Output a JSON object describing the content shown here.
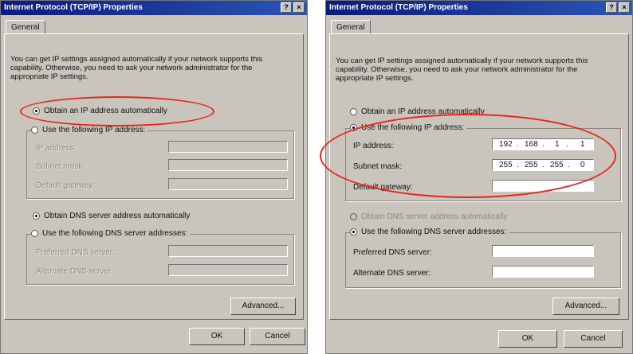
{
  "left_dialog": {
    "title": "Internet Protocol (TCP/IP) Properties",
    "help_btn": "?",
    "close_btn": "×",
    "tab": "General",
    "description": "You can get IP settings assigned automatically if your network supports this capability. Otherwise, you need to ask your network administrator for the appropriate IP settings.",
    "radio_auto_ip": "Obtain an IP address automatically",
    "radio_manual_ip": "Use the following IP address:",
    "ip_label": "IP address:",
    "subnet_label": "Subnet mask:",
    "gateway_label": "Default gateway:",
    "radio_auto_dns": "Obtain DNS server address automatically",
    "radio_manual_dns": "Use the following DNS server addresses:",
    "pref_dns_label": "Preferred DNS server:",
    "alt_dns_label": "Alternate DNS server:",
    "advanced": "Advanced...",
    "ok": "OK",
    "cancel": "Cancel"
  },
  "right_dialog": {
    "title": "Internet Protocol (TCP/IP) Properties",
    "help_btn": "?",
    "close_btn": "×",
    "tab": "General",
    "description": "You can get IP settings assigned automatically if your network supports this capability. Otherwise, you need to ask your network administrator for the appropriate IP settings.",
    "radio_auto_ip": "Obtain an IP address automatically",
    "radio_manual_ip": "Use the following IP address:",
    "ip_label": "IP address:",
    "ip_value": [
      "192",
      "168",
      "1",
      "1"
    ],
    "subnet_label": "Subnet mask:",
    "subnet_value": [
      "255",
      "255",
      "255",
      "0"
    ],
    "gateway_label": "Default gateway:",
    "radio_auto_dns": "Obtain DNS server address automatically",
    "radio_manual_dns": "Use the following DNS server addresses:",
    "pref_dns_label": "Preferred DNS server:",
    "alt_dns_label": "Alternate DNS server:",
    "advanced": "Advanced...",
    "ok": "OK",
    "cancel": "Cancel"
  },
  "colors": {
    "titlebar": "#0a1a7a",
    "highlight_oval": "#e8251f",
    "dialog_bg": "#c9c5bd"
  }
}
